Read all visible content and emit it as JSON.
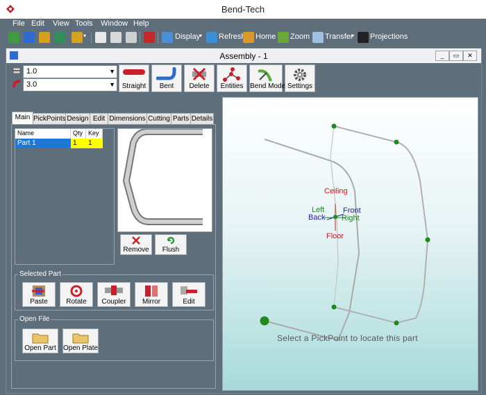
{
  "app": {
    "title": "Bend-Tech"
  },
  "menu": [
    "File",
    "Edit",
    "View",
    "Tools",
    "Window",
    "Help"
  ],
  "toolbar": {
    "display": "Display",
    "refresh": "Refresh",
    "home": "Home",
    "zoom": "Zoom",
    "transfer": "Transfer",
    "projections": "Projections"
  },
  "window": {
    "title": "Assembly - 1",
    "minimize": "_",
    "restore": "▭",
    "close": "✕"
  },
  "combos": {
    "first_value": "1.0",
    "second_value": "3.0"
  },
  "tools": [
    "Straight",
    "Bent",
    "Delete",
    "Entities",
    "Bend Mode",
    "Settings"
  ],
  "tabs": [
    "Main",
    "PickPoints",
    "Design",
    "Edit",
    "Dimensions",
    "Cutting",
    "Parts",
    "Details"
  ],
  "parts_grid": {
    "headers": [
      "Name",
      "Qty",
      "Key"
    ],
    "rows": [
      {
        "name": "Part 1",
        "qty": "1",
        "key": "1"
      }
    ]
  },
  "preview_actions": {
    "remove": "Remove",
    "flush": "Flush"
  },
  "selected_part": {
    "label": "Selected Part",
    "buttons": [
      "Paste",
      "Rotate",
      "Coupler",
      "Mirror",
      "Edit"
    ]
  },
  "open_file": {
    "label": "Open File",
    "buttons": [
      "Open Part",
      "Open Plate"
    ]
  },
  "viewport": {
    "labels": {
      "ceiling": "Ceiling",
      "left": "Left",
      "front": "Front",
      "back": "Back",
      "right": "Right",
      "floor": "Floor"
    },
    "instruction": "Select a PickPoint to locate this part"
  },
  "colors": {
    "chrome": "#5f6e7b",
    "ceiling_floor": "#d01818",
    "left_right": "#1a8a1a",
    "front_back": "#1a1aa8",
    "pickpoint": "#1c8a1c",
    "selection": "#1e78d7",
    "key_cell": "#ffff00"
  }
}
